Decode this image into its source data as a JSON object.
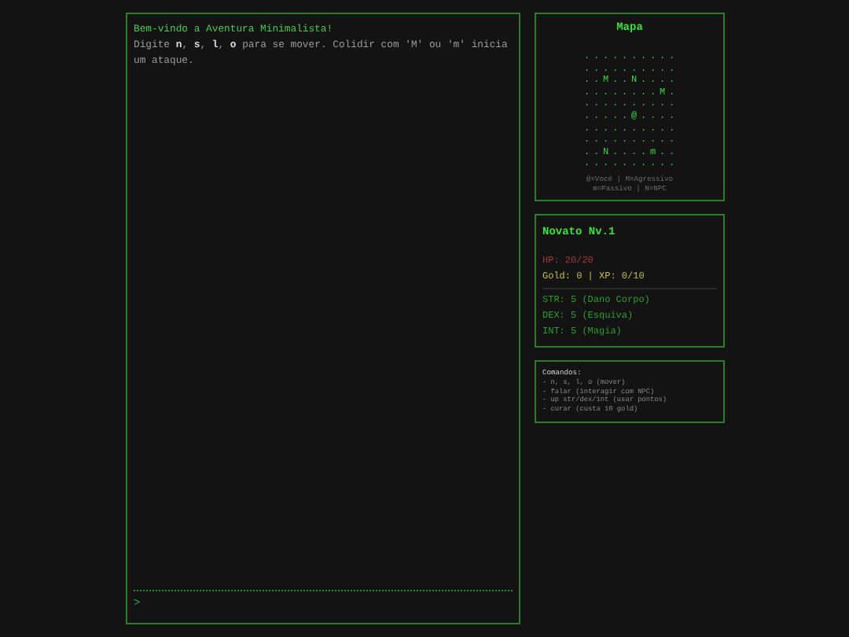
{
  "console": {
    "welcome": "Bem-vindo a Aventura Minimalista!",
    "intro": "Digite **n**, **s**, **l**, **o** para se mover. Colidir com 'M' ou 'm' inicia um ataque.",
    "prompt": ">"
  },
  "map": {
    "title": "Mapa",
    "rows": [
      "..........",
      "..........",
      "..M..N....",
      "........M.",
      "..........",
      ".....@....",
      "..........",
      "..........",
      "..N....m..",
      ".........."
    ],
    "legend": [
      "@=Você | M=Agressivo",
      "m=Passivo | N=NPC"
    ]
  },
  "character": {
    "name": "Novato Nv.1",
    "hp": "HP: 20/20",
    "gold": "Gold: 0 | XP: 0/10",
    "stats": [
      "STR: 5 (Dano Corpo)",
      "DEX: 5 (Esquiva)",
      "INT: 5 (Magia)"
    ]
  },
  "commands": {
    "title": "Comandos:",
    "items": [
      "- n, s, l, o (mover)",
      "- falar (interagir com NPC)",
      "- up str/dex/int (usar pontos)",
      "- curar (custa 10 gold)"
    ]
  }
}
